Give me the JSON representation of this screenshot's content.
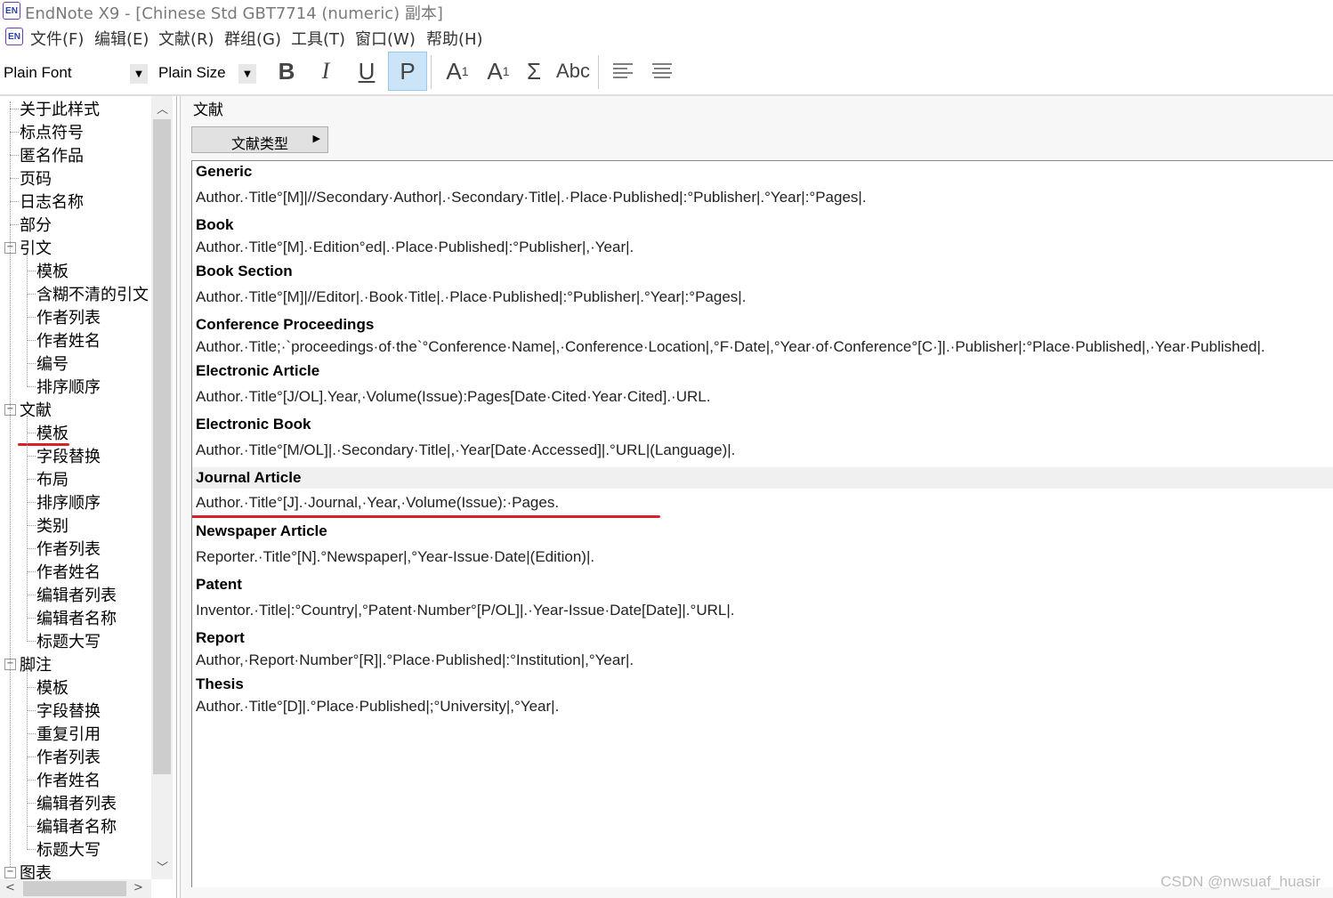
{
  "window": {
    "icon_text": "EN",
    "title": "EndNote X9 - [Chinese Std GBT7714 (numeric)  副本]"
  },
  "menu": [
    "文件(F)",
    "编辑(E)",
    "文献(R)",
    "群组(G)",
    "工具(T)",
    "窗口(W)",
    "帮助(H)"
  ],
  "toolbar": {
    "font": "Plain Font",
    "size": "Plain Size",
    "bold": "B",
    "italic": "I",
    "underline": "U",
    "plain": "P",
    "superscript": "A",
    "superscript_mark": "1",
    "subscript": "A",
    "subscript_mark": "1",
    "sigma": "Σ",
    "smallcaps": "Abc"
  },
  "sidebar": {
    "items": [
      {
        "label": "关于此样式",
        "level": 1
      },
      {
        "label": "标点符号",
        "level": 1
      },
      {
        "label": "匿名作品",
        "level": 1
      },
      {
        "label": "页码",
        "level": 1
      },
      {
        "label": "日志名称",
        "level": 1
      },
      {
        "label": "部分",
        "level": 1
      },
      {
        "label": "引文",
        "level": 0,
        "toggle": "−"
      },
      {
        "label": "模板",
        "level": 2
      },
      {
        "label": "含糊不清的引文",
        "level": 2
      },
      {
        "label": "作者列表",
        "level": 2
      },
      {
        "label": "作者姓名",
        "level": 2
      },
      {
        "label": "编号",
        "level": 2
      },
      {
        "label": "排序顺序",
        "level": 2
      },
      {
        "label": "文献",
        "level": 0,
        "toggle": "−"
      },
      {
        "label": "模板",
        "level": 2,
        "selected": true
      },
      {
        "label": "字段替换",
        "level": 2
      },
      {
        "label": "布局",
        "level": 2
      },
      {
        "label": "排序顺序",
        "level": 2
      },
      {
        "label": "类别",
        "level": 2
      },
      {
        "label": "作者列表",
        "level": 2
      },
      {
        "label": "作者姓名",
        "level": 2
      },
      {
        "label": "编辑者列表",
        "level": 2
      },
      {
        "label": "编辑者名称",
        "level": 2
      },
      {
        "label": "标题大写",
        "level": 2
      },
      {
        "label": "脚注",
        "level": 0,
        "toggle": "−"
      },
      {
        "label": "模板",
        "level": 2
      },
      {
        "label": "字段替换",
        "level": 2
      },
      {
        "label": "重复引用",
        "level": 2
      },
      {
        "label": "作者列表",
        "level": 2
      },
      {
        "label": "作者姓名",
        "level": 2
      },
      {
        "label": "编辑者列表",
        "level": 2
      },
      {
        "label": "编辑者名称",
        "level": 2
      },
      {
        "label": "标题大写",
        "level": 2
      },
      {
        "label": "图表",
        "level": 0,
        "toggle": "−"
      }
    ]
  },
  "content": {
    "section": "文献",
    "reftype_button": "文献类型",
    "entries": [
      {
        "type": "Generic",
        "template": "Author.·Title°[M]|//Secondary·Author|.·Secondary·Title|.·Place·Published|:°Publisher|.°Year|:°Pages|."
      },
      {
        "type": "Book",
        "template": "Author.·Title°[M].·Edition°ed|.·Place·Published|:°Publisher|,·Year|."
      },
      {
        "type": "Book Section",
        "template": "Author.·Title°[M]|//Editor|.·Book·Title|.·Place·Published|:°Publisher|.°Year|:°Pages|."
      },
      {
        "type": "Conference Proceedings",
        "template": "Author.·Title;·`proceedings·of·the`°Conference·Name|,·Conference·Location|,°F·Date|,°Year·of·Conference°[C·]|.·Publisher|:°Place·Published|,·Year·Published|."
      },
      {
        "type": "Electronic Article",
        "template": "Author.·Title°[J/OL].Year,·Volume(Issue):Pages[Date·Cited·Year·Cited].·URL."
      },
      {
        "type": "Electronic Book",
        "template": "Author.·Title°[M/OL]|.·Secondary·Title|,·Year[Date·Accessed]|.°URL|(Language)|."
      },
      {
        "type": "Journal Article",
        "template": "Author.·Title°[J].·Journal,·Year,·Volume(Issue):·Pages.",
        "highlighted": true
      },
      {
        "type": "Newspaper Article",
        "template": "Reporter.·Title°[N].°Newspaper|,°Year-Issue·Date|(Edition)|."
      },
      {
        "type": "Patent",
        "template": "Inventor.·Title|:°Country|,°Patent·Number°[P/OL]|.·Year-Issue·Date[Date]|.°URL|."
      },
      {
        "type": "Report",
        "template": "Author,·Report·Number°[R]|.°Place·Published|:°Institution|,°Year|."
      },
      {
        "type": "Thesis",
        "template": "Author.·Title°[D]|.°Place·Published|;°University|,°Year|."
      }
    ]
  },
  "watermark": "CSDN @nwsuaf_huasir",
  "colors": {
    "annotation_red": "#d8202a",
    "active_button": "#cce4f7"
  }
}
